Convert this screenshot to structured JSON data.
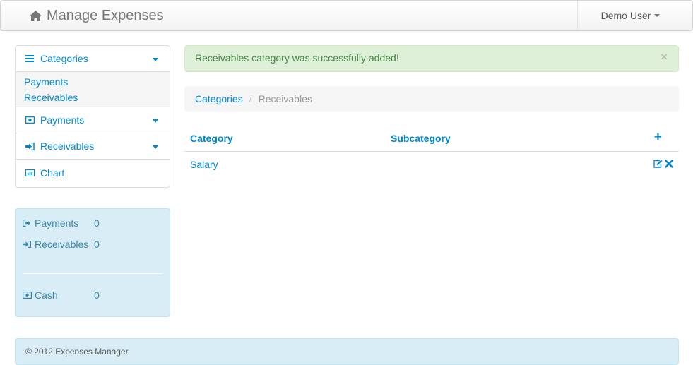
{
  "navbar": {
    "brand": "Manage Expenses",
    "brand_icon": "home-icon",
    "user": "Demo User"
  },
  "sidebar": {
    "sections": [
      {
        "label": "Categories",
        "icon": "list-icon",
        "expanded": true,
        "items": [
          {
            "label": "Payments"
          },
          {
            "label": "Receivables"
          }
        ]
      },
      {
        "label": "Payments",
        "icon": "money-icon",
        "expanded": false
      },
      {
        "label": "Receivables",
        "icon": "sign-in-icon",
        "expanded": false
      },
      {
        "label": "Chart",
        "icon": "bar-chart-icon",
        "expanded": false
      }
    ]
  },
  "stats": {
    "payments_label": "Payments",
    "payments_value": "0",
    "receivables_label": "Receivables",
    "receivables_value": "0",
    "cash_label": "Cash",
    "cash_value": "0"
  },
  "alert": {
    "message": "Receivables category was successfully added!",
    "close": "×"
  },
  "breadcrumb": {
    "items": [
      "Categories",
      "Receivables"
    ],
    "divider": "/"
  },
  "table": {
    "headers": [
      "Category",
      "Subcategory"
    ],
    "add": "+",
    "rows": [
      {
        "category": "Salary",
        "subcategory": ""
      }
    ]
  },
  "footer": {
    "text": "© 2012 Expenses Manager"
  },
  "colors": {
    "link": "#0088cc",
    "alert_bg": "#dff0d8",
    "alert_text": "#468847",
    "info_bg": "#d9edf7",
    "info_text": "#3a87ad"
  }
}
